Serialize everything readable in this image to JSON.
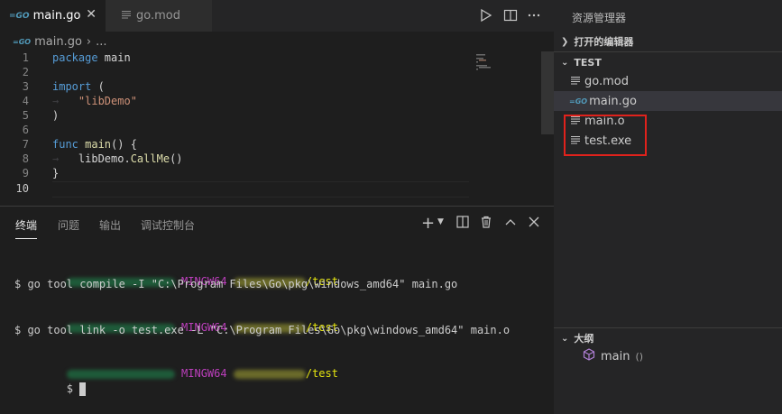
{
  "editor": {
    "tabs": [
      {
        "label": "main.go",
        "icon": "go-file-icon",
        "active": true
      },
      {
        "label": "go.mod",
        "icon": "lines-file-icon",
        "active": false
      }
    ],
    "breadcrumb": {
      "file": "main.go",
      "rest": "..."
    },
    "code_lines": [
      {
        "num": "1"
      },
      {
        "num": "2"
      },
      {
        "num": "3"
      },
      {
        "num": "4"
      },
      {
        "num": "5"
      },
      {
        "num": "6"
      },
      {
        "num": "7"
      },
      {
        "num": "8"
      },
      {
        "num": "9"
      },
      {
        "num": "10"
      }
    ],
    "code": {
      "l1_kw": "package",
      "l1_name": " main",
      "l3_kw": "import",
      "l3_paren": " (",
      "l4_str": "\"libDemo\"",
      "l5_paren": ")",
      "l7_kw": "func",
      "l7_fn": " main",
      "l7_rest": "() {",
      "l8_obj": "libDemo.",
      "l8_fn": "CallMe",
      "l8_rest": "()",
      "l9_brace": "}"
    }
  },
  "panel": {
    "tabs": [
      {
        "label": "终端",
        "active": true
      },
      {
        "label": "问题",
        "active": false
      },
      {
        "label": "输出",
        "active": false
      },
      {
        "label": "调试控制台",
        "active": false
      }
    ],
    "terminal": {
      "mingw": "MINGW64",
      "path_suffix": "/test",
      "cmd1": "$ go tool compile -I \"C:\\Program Files\\Go\\pkg\\windows_amd64\" main.go",
      "cmd2": "$ go tool link -o test.exe -L \"C:\\Program Files\\Go\\pkg\\windows_amd64\" main.o",
      "prompt": "$ "
    }
  },
  "sidebar": {
    "title": "资源管理器",
    "open_editors": "打开的编辑器",
    "folder": "TEST",
    "files": [
      {
        "name": "go.mod",
        "icon": "lines-file-icon"
      },
      {
        "name": "main.go",
        "icon": "go-file-icon",
        "selected": true
      },
      {
        "name": "main.o",
        "icon": "lines-file-icon"
      },
      {
        "name": "test.exe",
        "icon": "lines-file-icon"
      }
    ],
    "outline": {
      "title": "大纲",
      "item": "main",
      "item_suffix": "()"
    }
  },
  "colors": {
    "highlight_box": "#e0221c",
    "keyword": "#569cd6",
    "function": "#dcdcaa",
    "string": "#ce9178",
    "mingw": "#bc3fbc",
    "path": "#e5e510"
  }
}
